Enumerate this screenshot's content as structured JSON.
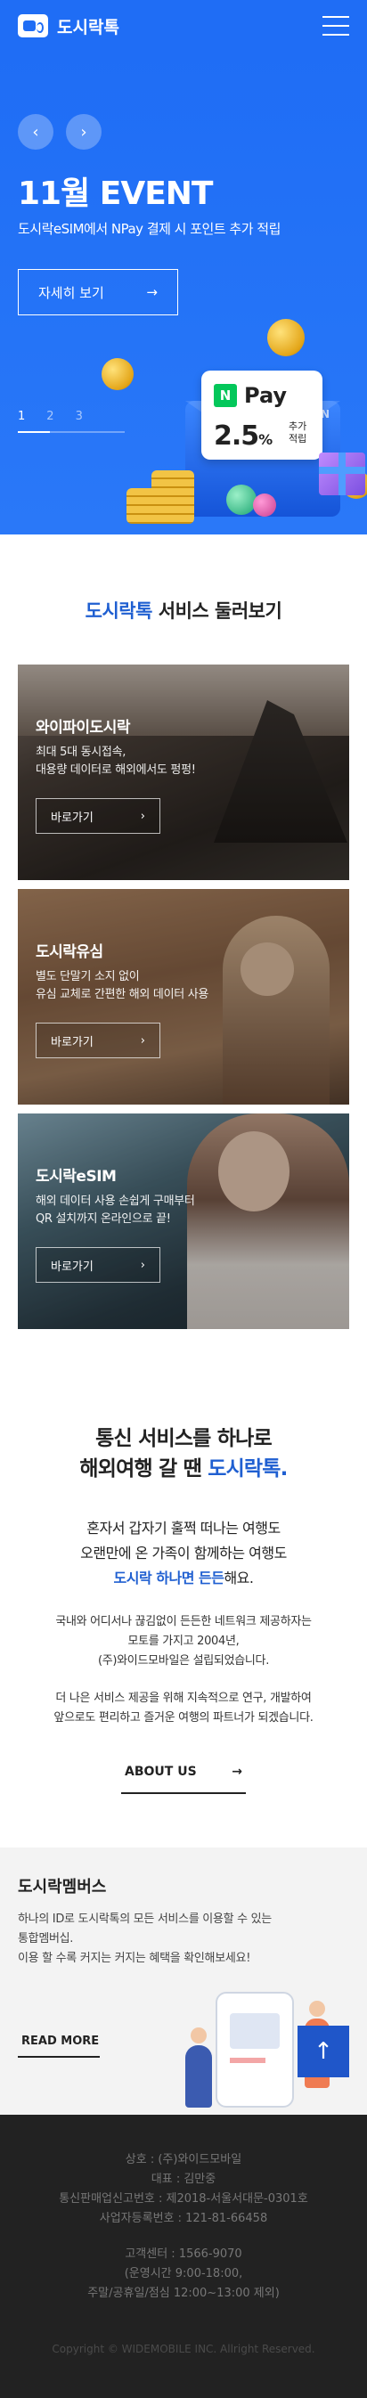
{
  "header": {
    "brand": "도시락톡",
    "logo_icon": "chat-bubble-icon",
    "menu_icon": "hamburger-icon"
  },
  "hero": {
    "prev_icon": "‹",
    "next_icon": "›",
    "title": "11월 EVENT",
    "subtitle": "도시락eSIM에서 NPay 결제 시 포인트 추가 적립",
    "cta_label": "자세히 보기",
    "cta_arrow": "→",
    "pages": [
      "1",
      "2",
      "3"
    ],
    "active_page": "1",
    "badge_letter": "N",
    "pay_word": "Pay",
    "rate": "2.5",
    "rate_unit": "%",
    "rate_note_1": "추가",
    "rate_note_2": "적립",
    "envelope_mark": "N"
  },
  "services": {
    "title_brand": "도시락톡",
    "title_rest": " 서비스 둘러보기",
    "cards": [
      {
        "title": "와이파이도시락",
        "desc_1": "최대 5대 동시접속,",
        "desc_2": "대용량 데이터로 해외에서도 펑펑!",
        "button": "바로가기",
        "arrow": "›"
      },
      {
        "title": "도시락유심",
        "desc_1": "별도 단말기 소지 없이",
        "desc_2": "유심 교체로 간편한 해외 데이터 사용",
        "button": "바로가기",
        "arrow": "›"
      },
      {
        "title": "도시락eSIM",
        "desc_1": "해외 데이터 사용 손쉽게 구매부터",
        "desc_2": "QR 설치까지 온라인으로 끝!",
        "button": "바로가기",
        "arrow": "›"
      }
    ]
  },
  "intro": {
    "head_1": "통신 서비스를 하나로",
    "head_2a": "해외여행 갈 땐 ",
    "head_2b": "도시락톡.",
    "lead_1": "혼자서 갑자기 훌쩍 떠나는 여행도",
    "lead_2": "오랜만에 온 가족이 함께하는 여행도",
    "lead_3a": "도시락 하나면 든든",
    "lead_3b": "해요.",
    "text_1": "국내와 어디서나 끊김없이 든든한 네트워크 제공하자는",
    "text_2": "모토를 가지고 2004년,",
    "text_3": "(주)와이드모바일은 설립되었습니다.",
    "text_4": "더 나은 서비스 제공을 위해 지속적으로 연구, 개발하여",
    "text_5": "앞으로도 편리하고 즐거운 여행의 파트너가 되겠습니다.",
    "about_label": "ABOUT US",
    "about_arrow": "→"
  },
  "membership": {
    "title": "도시락멤버스",
    "desc_1": "하나의 ID로 도시락톡의 모든 서비스를 이용할 수 있는",
    "desc_2": "통합멤버십.",
    "desc_3": "이용 할 수록 커지는 커지는 혜택을 확인해보세요!",
    "button": "READ MORE",
    "top_icon": "↑"
  },
  "footer": {
    "company": "상호 : (주)와이드모바일",
    "ceo": "대표 : 김만중",
    "telecom_reg": "통신판매업신고번호 : 제2018-서울서대문-0301호",
    "biz_reg": "사업자등록번호 : 121-81-66458",
    "center": "고객센터 : 1566-9070",
    "hours": "(운영시간 9:00-18:00,",
    "hours_2": "주말/공휴일/점심 12:00~13:00 제외)",
    "copyright": "Copyright © WIDEMOBILE INC. Allright Reserved."
  },
  "colors": {
    "brand_blue": "#1f6df5",
    "brand_text": "#1f5fd1",
    "npay_green": "#03c75a",
    "footer_bg": "#222222"
  }
}
